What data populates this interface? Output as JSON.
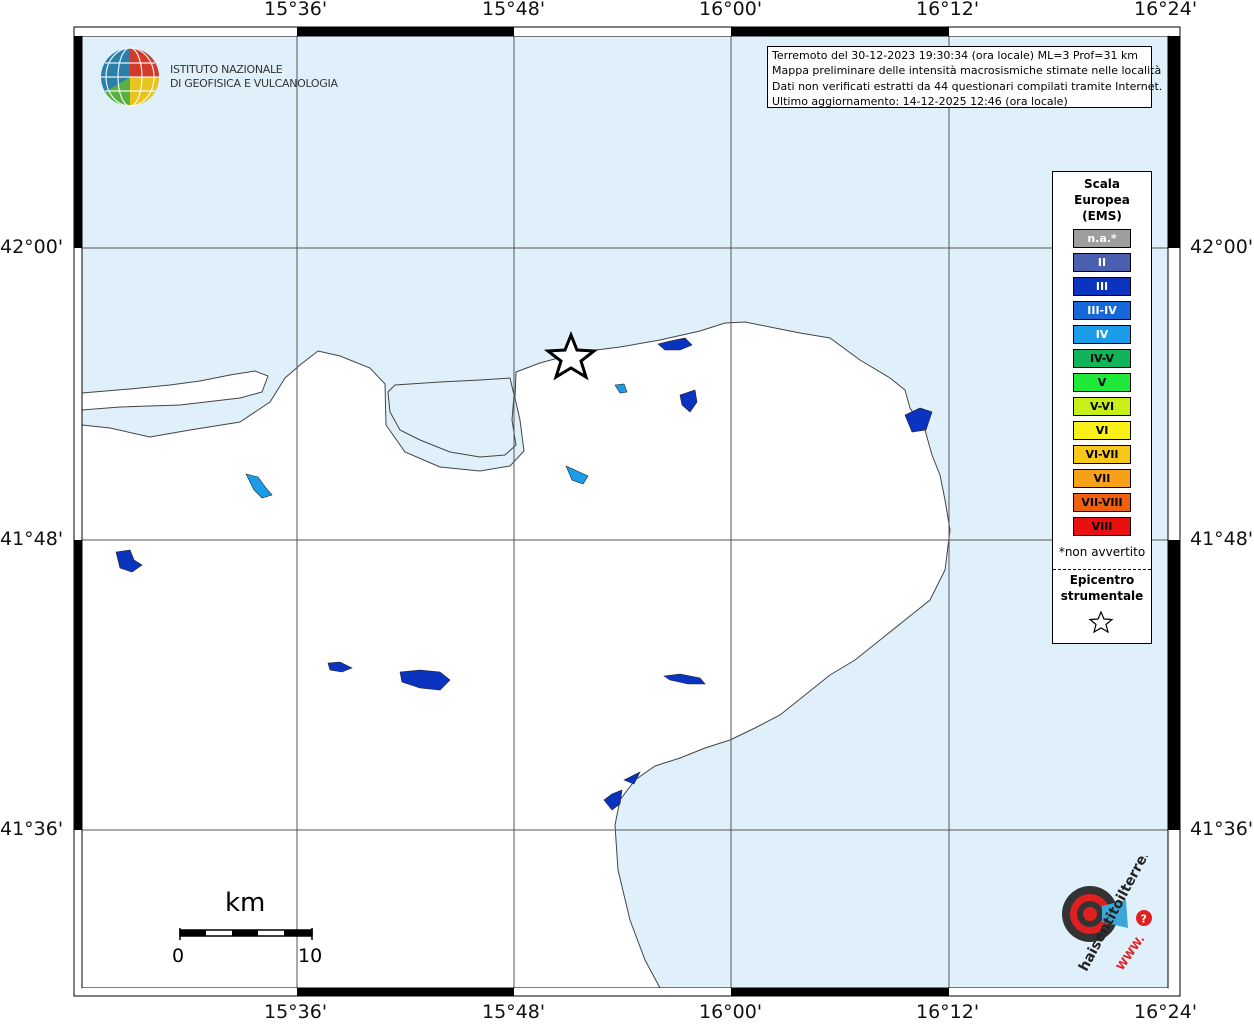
{
  "header": {
    "info_lines": [
      "Terremoto del 30-12-2023 19:30:34 (ora locale) ML=3 Prof=31 km",
      "Mappa preliminare delle intensità macrosismiche stimate nelle località",
      "Dati non verificati estratti da 44 questionari compilati tramite Internet.",
      "Ultimo aggiornamento: 14-12-2025 12:46 (ora locale)"
    ]
  },
  "branding": {
    "institute_line1": "ISTITUTO NAZIONALE",
    "institute_line2": "DI GEOFISICA E VULCANOLOGIA",
    "site_logo_text": "haisentitoilterremoto.it",
    "site_www": "WWW.",
    "site_question": "?"
  },
  "axes": {
    "lon_labels": [
      "15°36'",
      "15°48'",
      "16°00'",
      "16°12'",
      "16°24'"
    ],
    "lat_labels": [
      "42°00'",
      "41°48'",
      "41°36'"
    ]
  },
  "legend": {
    "title": [
      "Scala",
      "Europea",
      "(EMS)"
    ],
    "classes": [
      {
        "label": "n.a.*",
        "color": "#9e9e9e",
        "text": "light"
      },
      {
        "label": "II",
        "color": "#4a5fb0",
        "text": "light"
      },
      {
        "label": "III",
        "color": "#0a33c0",
        "text": "light"
      },
      {
        "label": "III-IV",
        "color": "#1468d8",
        "text": "light"
      },
      {
        "label": "IV",
        "color": "#1a9ce8",
        "text": "light"
      },
      {
        "label": "IV-V",
        "color": "#12b45a",
        "text": "dark"
      },
      {
        "label": "V",
        "color": "#1ee838",
        "text": "dark"
      },
      {
        "label": "V-VI",
        "color": "#c8f018",
        "text": "dark"
      },
      {
        "label": "VI",
        "color": "#f8f018",
        "text": "dark"
      },
      {
        "label": "VI-VII",
        "color": "#f8c818",
        "text": "dark"
      },
      {
        "label": "VII",
        "color": "#f8a018",
        "text": "dark"
      },
      {
        "label": "VII-VIII",
        "color": "#f06010",
        "text": "dark"
      },
      {
        "label": "VIII",
        "color": "#e81010",
        "text": "dark"
      }
    ],
    "footnote": "*non avvertito",
    "epicenter_title": [
      "Epicentro",
      "strumentale"
    ]
  },
  "scale": {
    "unit": "km",
    "min_label": "0",
    "max_label": "10"
  },
  "colors": {
    "sea": "#dff0fb",
    "land": "#ffffff",
    "intensity_III": "#0a33c0",
    "intensity_IV": "#1a9ce8"
  }
}
